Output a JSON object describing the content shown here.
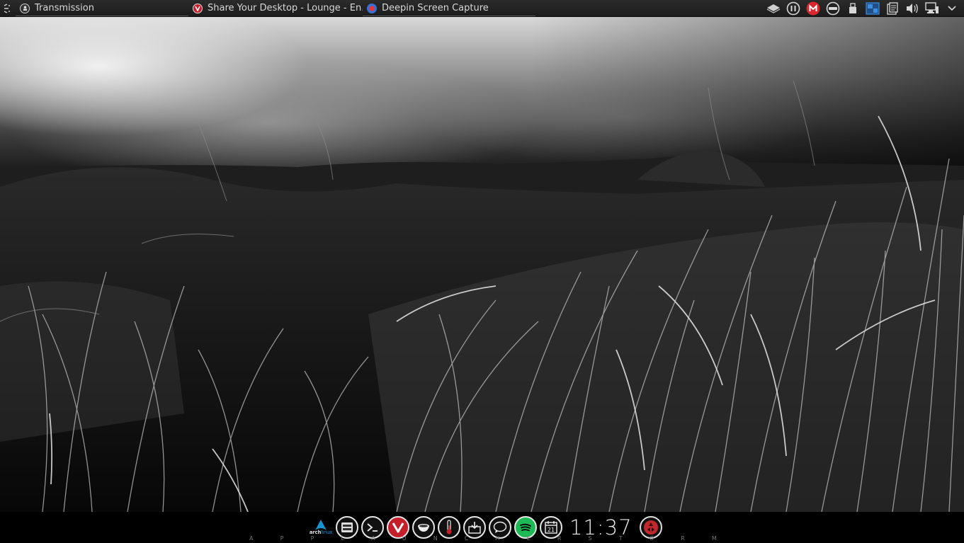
{
  "top_panel": {
    "tasks": [
      {
        "title": "Transmission",
        "icon": "transmission-icon"
      },
      {
        "title": "Share Your Desktop - Lounge - En...",
        "icon": "vivaldi-icon"
      },
      {
        "title": "Deepin Screen Capture",
        "icon": "deepin-screenshot-icon"
      }
    ],
    "tray_icons": [
      "dropbox-icon",
      "caffeine-icon",
      "mega-icon",
      "disk-icon",
      "usb-icon",
      "pager-icon",
      "clipboard-icon",
      "volume-icon",
      "network-icon",
      "expand-tray-icon"
    ]
  },
  "dock": {
    "arch_label": "arch",
    "arch_label_accent": "linux",
    "apps": [
      "file-manager-icon",
      "terminal-icon",
      "vivaldi-icon",
      "caffeine-icon",
      "thermometer-icon",
      "installer-icon",
      "chat-icon",
      "spotify-icon",
      "calendar-icon"
    ],
    "calendar_day": "21",
    "clock": "11:37",
    "trash_icon": "trash-icon",
    "letters": [
      "A",
      "P",
      "P",
      "L",
      "A",
      "U",
      "N",
      "C",
      "H",
      "E",
      "R",
      "S",
      "T",
      "O",
      "R",
      "M"
    ]
  },
  "colors": {
    "panel_bg": "#1c1c1c",
    "mega_red": "#d9272e",
    "vivaldi_red": "#c41f2a",
    "spotify_green": "#1db954",
    "arch_blue": "#1793d1",
    "trash_red": "#c0282d",
    "pager_blue": "#3d8ee0"
  }
}
